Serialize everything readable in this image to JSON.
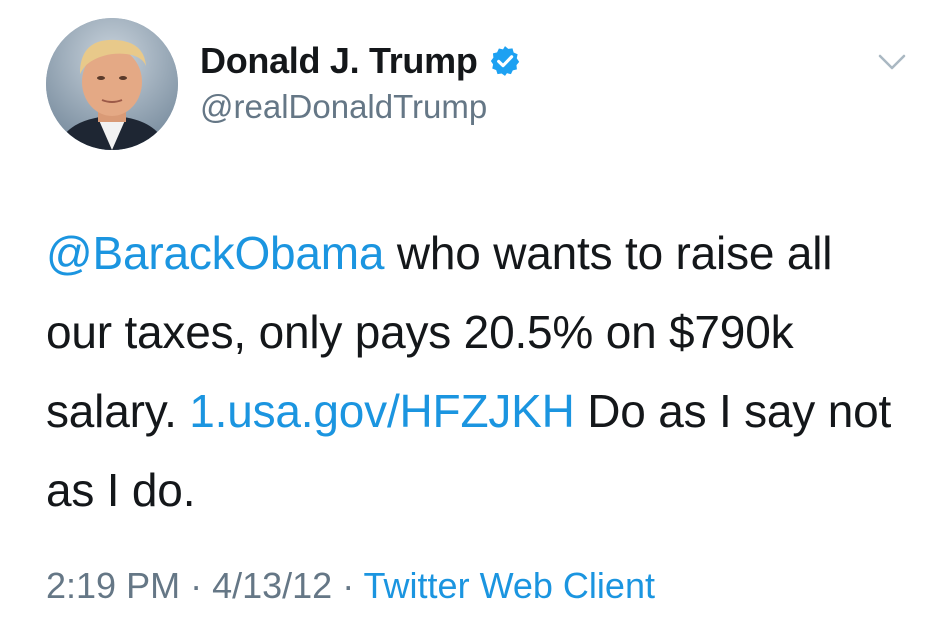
{
  "user": {
    "display_name": "Donald J. Trump",
    "handle": "@realDonaldTrump",
    "verified_icon": "verified-badge-icon",
    "avatar_description": "avatar"
  },
  "tweet": {
    "mention": "@BarackObama",
    "text_part1": " who wants to raise all our taxes, only pays 20.5% on $790k salary. ",
    "link": "1.usa.gov/HFZJKH",
    "text_part2": " Do as I say not as I do."
  },
  "meta": {
    "time": "2:19 PM",
    "separator1": " · ",
    "date": "4/13/12",
    "separator2": " · ",
    "source": "Twitter Web Client"
  },
  "menu": {
    "icon": "chevron-down-icon"
  },
  "colors": {
    "link": "#1b95e0",
    "secondary_text": "#657786",
    "primary_text": "#14171a",
    "verified": "#1da1f2"
  }
}
